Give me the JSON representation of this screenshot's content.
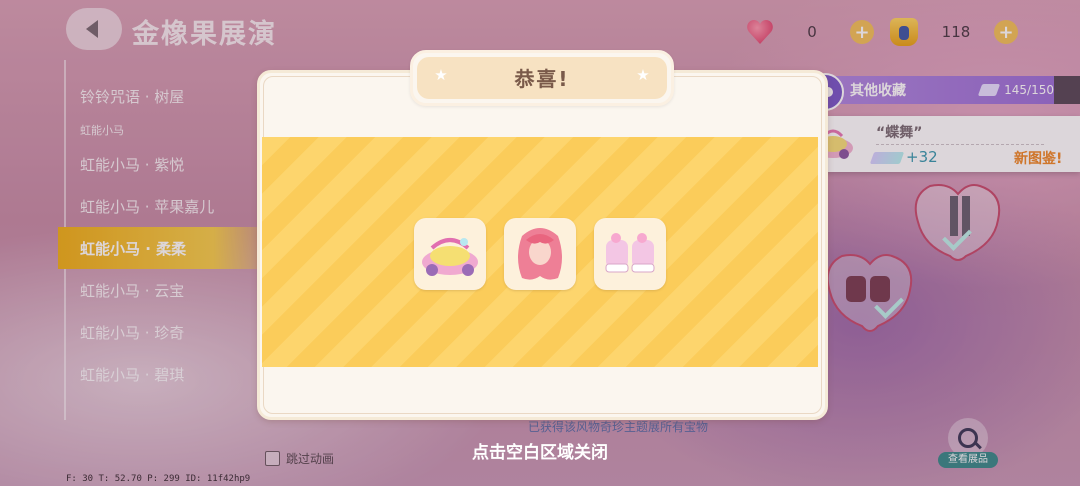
{
  "header": {
    "back_label": "",
    "title": "金橡果展演"
  },
  "currency": {
    "hearts": "0",
    "acorns": "118"
  },
  "sidebar": {
    "items_top": [
      "铃铃咒语 · 树屋"
    ],
    "group_label": "虹能小马",
    "items": [
      {
        "label": "虹能小马 · 紫悦",
        "active": false
      },
      {
        "label": "虹能小马 · 苹果嘉儿",
        "active": false
      },
      {
        "label": "虹能小马 · 柔柔",
        "active": true
      },
      {
        "label": "虹能小马 · 云宝",
        "active": false
      },
      {
        "label": "虹能小马 · 珍奇",
        "active": false
      },
      {
        "label": "虹能小马 · 碧琪",
        "active": false
      }
    ]
  },
  "skip_animation_label": "跳过动画",
  "debug_text": "F: 30   T: 52.70   P: 299   ID: 11f42hp9",
  "collection": {
    "label": "其他收藏",
    "count": "145/150"
  },
  "new_card": {
    "name": "“蝶舞”",
    "tickets": "+32",
    "new_tag": "新图鉴!"
  },
  "all_obtained_hint": "已获得该风物奇珍主题展所有宝物",
  "view_button_label": "查看展品",
  "modal": {
    "title": "恭喜!",
    "rewards": [
      "pink-car-icon",
      "pink-hair-icon",
      "pink-shoes-icon"
    ]
  },
  "close_hint": "点击空白区域关闭",
  "colors": {
    "accent_yellow": "#f7cf4d",
    "purple_bar": "#9b6fd6",
    "modal_bg": "#fbf6ef"
  }
}
